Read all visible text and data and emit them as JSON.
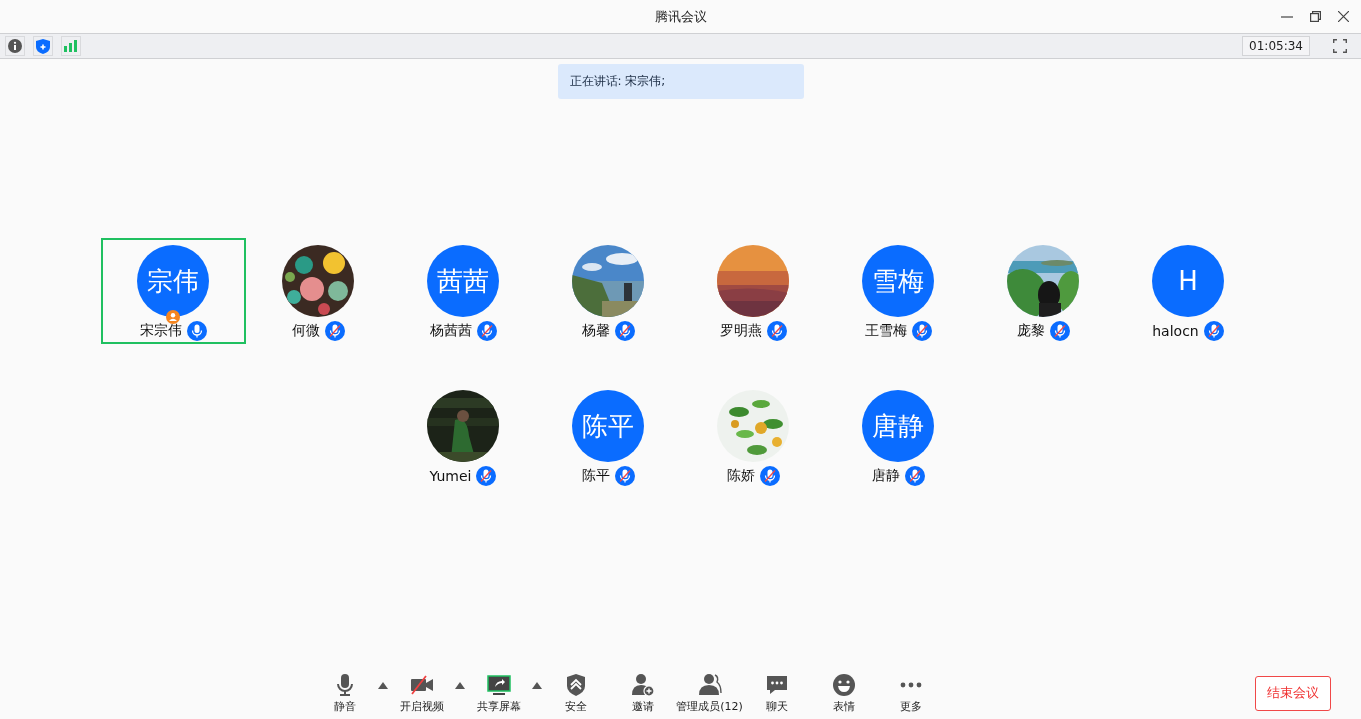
{
  "window": {
    "title": "腾讯会议"
  },
  "info_bar": {
    "timer": "01:05:34"
  },
  "speaking_banner": "正在讲话: 宋宗伟;",
  "participants": [
    {
      "name": "宋宗伟",
      "avatar": {
        "kind": "initials",
        "text": "宗伟"
      },
      "host": true,
      "speaking": true,
      "muted": false
    },
    {
      "name": "何微",
      "host": false,
      "speaking": false,
      "muted": true
    },
    {
      "name": "杨茜茜",
      "avatar": {
        "kind": "initials",
        "text": "茜茜"
      },
      "host": false,
      "speaking": false,
      "muted": true
    },
    {
      "name": "杨馨",
      "host": false,
      "speaking": false,
      "muted": true
    },
    {
      "name": "罗明燕",
      "host": false,
      "speaking": false,
      "muted": true
    },
    {
      "name": "王雪梅",
      "avatar": {
        "kind": "initials",
        "text": "雪梅"
      },
      "host": false,
      "speaking": false,
      "muted": true
    },
    {
      "name": "庞黎",
      "host": false,
      "speaking": false,
      "muted": true
    },
    {
      "name": "halocn",
      "avatar": {
        "kind": "initials",
        "text": "H"
      },
      "host": false,
      "speaking": false,
      "muted": true
    },
    {
      "name": "Yumei",
      "host": false,
      "speaking": false,
      "muted": true
    },
    {
      "name": "陈平",
      "avatar": {
        "kind": "initials",
        "text": "陈平"
      },
      "host": false,
      "speaking": false,
      "muted": true
    },
    {
      "name": "陈娇",
      "host": false,
      "speaking": false,
      "muted": true
    },
    {
      "name": "唐静",
      "avatar": {
        "kind": "initials",
        "text": "唐静"
      },
      "host": false,
      "speaking": false,
      "muted": true
    }
  ],
  "toolbar": [
    {
      "kind": "mute",
      "label": "静音",
      "menu": true
    },
    {
      "kind": "video",
      "label": "开启视频",
      "menu": true
    },
    {
      "kind": "share",
      "label": "共享屏幕",
      "menu": true
    },
    {
      "kind": "security",
      "label": "安全",
      "menu": false
    },
    {
      "kind": "invite",
      "label": "邀请",
      "menu": false
    },
    {
      "kind": "members",
      "label": "管理成员(12)",
      "menu": false
    },
    {
      "kind": "chat",
      "label": "聊天",
      "menu": false
    },
    {
      "kind": "emoji",
      "label": "表情",
      "menu": false
    },
    {
      "kind": "more",
      "label": "更多",
      "menu": false
    }
  ],
  "end_button": "结束会议"
}
